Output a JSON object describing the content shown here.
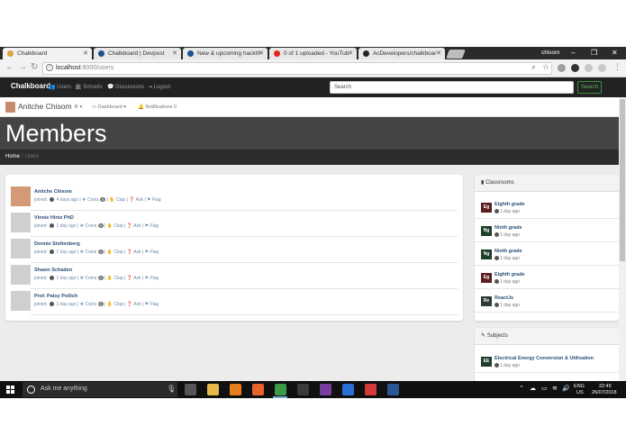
{
  "browser": {
    "tabs": [
      {
        "title": "Chalkboard",
        "favicon_color": "#d9a441"
      },
      {
        "title": "Chalkboard | Devpost",
        "favicon_color": "#1a4f8a"
      },
      {
        "title": "New & upcoming hackth",
        "favicon_color": "#1a4f8a"
      },
      {
        "title": "0 of 1 uploaded - YouTub",
        "favicon_color": "#e62117"
      },
      {
        "title": "AcDevelopers/chalkboar",
        "favicon_color": "#222222"
      }
    ],
    "window_user": "chisom",
    "url_host": "localhost",
    "url_path": ":8000/users"
  },
  "navbar": {
    "brand": "Chalkboard",
    "links": [
      "Users",
      "Schools",
      "Discussions",
      "Logout"
    ],
    "search_placeholder": "Search",
    "search_button": "Search"
  },
  "subnav": {
    "user_name": "Anitche Chisom",
    "dashboard_label": "Dashboard",
    "notifications_label": "Notifications",
    "notifications_count": "0"
  },
  "page": {
    "title": "Members",
    "breadcrumb_home": "Home",
    "breadcrumb_sep": "/",
    "breadcrumb_current": "Users"
  },
  "members": [
    {
      "name": "Anitche Chisom",
      "joined": "4 days ago",
      "coins": "0",
      "has_photo": true
    },
    {
      "name": "Vinnie Hintz PhD",
      "joined": "1 day ago",
      "coins": "0",
      "has_photo": false
    },
    {
      "name": "Donnie Stoltenberg",
      "joined": "1 day ago",
      "coins": "0",
      "has_photo": false
    },
    {
      "name": "Shawn Schaden",
      "joined": "1 day ago",
      "coins": "0",
      "has_photo": false
    },
    {
      "name": "Prof. Patsy Pollich",
      "joined": "1 day ago",
      "coins": "0",
      "has_photo": false
    }
  ],
  "member_labels": {
    "joined": "joined:",
    "coins": "Coins",
    "clap": "Clap",
    "ask": "Ask",
    "flag": "Flag",
    "pipe": "|"
  },
  "sidebar": {
    "classrooms_title": "Classrooms",
    "classrooms": [
      {
        "tag": "Eg",
        "color": "#5a1f1f",
        "name": "Eighth grade",
        "time": "1 day ago"
      },
      {
        "tag": "Ng",
        "color": "#1f3d2a",
        "name": "Ninth grade",
        "time": "1 day ago"
      },
      {
        "tag": "Ng",
        "color": "#1f3d2a",
        "name": "Ninth grade",
        "time": "1 day ago"
      },
      {
        "tag": "Eg",
        "color": "#5a1f1f",
        "name": "Eighth grade",
        "time": "1 day ago"
      },
      {
        "tag": "Re",
        "color": "#2d3a33",
        "name": "ReactJs",
        "time": "1 day ago"
      }
    ],
    "subjects_title": "Subjects",
    "subjects": [
      {
        "tag": "EE",
        "color": "#1f3d2a",
        "name": "Electrical Energy Conversion & Utilisation",
        "time": "1 day ago"
      }
    ]
  },
  "taskbar": {
    "search_placeholder": "Ask me anything",
    "lang_top": "ENG",
    "lang_bottom": "US",
    "time": "22:45",
    "date": "26/07/2018",
    "apps": [
      {
        "name": "task-view",
        "color": "#555555"
      },
      {
        "name": "file-explorer",
        "color": "#e8b84a"
      },
      {
        "name": "vlc",
        "color": "#e87f1c"
      },
      {
        "name": "firefox",
        "color": "#e8622a"
      },
      {
        "name": "chrome",
        "color": "#3b9b48"
      },
      {
        "name": "terminal",
        "color": "#3a3a3a"
      },
      {
        "name": "app-purple",
        "color": "#7a3ea0"
      },
      {
        "name": "app-blue",
        "color": "#2a6fd6"
      },
      {
        "name": "app-red",
        "color": "#d43a3a"
      },
      {
        "name": "word",
        "color": "#2b5797"
      }
    ]
  }
}
